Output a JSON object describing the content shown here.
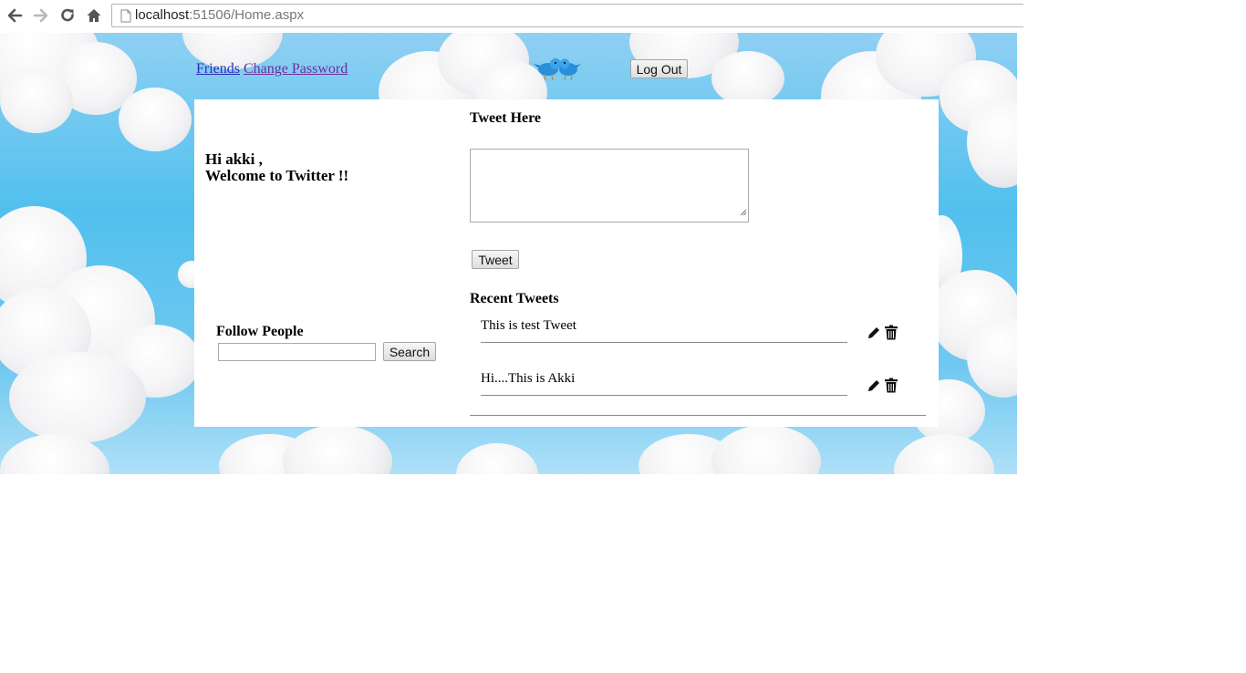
{
  "browser": {
    "url_host": "localhost",
    "url_path": ":51506/Home.aspx"
  },
  "header": {
    "friends_link": "Friends",
    "change_password_link": "Change Password",
    "logout_button": "Log Out",
    "logo_icon": "twitter-birds-icon"
  },
  "sidebar": {
    "greeting_line1": "Hi akki ,",
    "greeting_line2": "Welcome to Twitter !!",
    "follow_heading": "Follow People",
    "search_placeholder": "",
    "search_value": "",
    "search_button": "Search"
  },
  "main": {
    "tweet_heading": "Tweet Here",
    "tweet_value": "",
    "tweet_button": "Tweet",
    "recent_heading": "Recent Tweets",
    "tweets": [
      {
        "text": "This is test Tweet",
        "edit_icon": "pencil-icon",
        "delete_icon": "trash-icon"
      },
      {
        "text": "Hi....This is Akki",
        "edit_icon": "pencil-icon",
        "delete_icon": "trash-icon"
      }
    ]
  },
  "colors": {
    "link": "#2b2bb8",
    "link_visited": "#6a2e9e",
    "sky": "#52c0ee"
  }
}
